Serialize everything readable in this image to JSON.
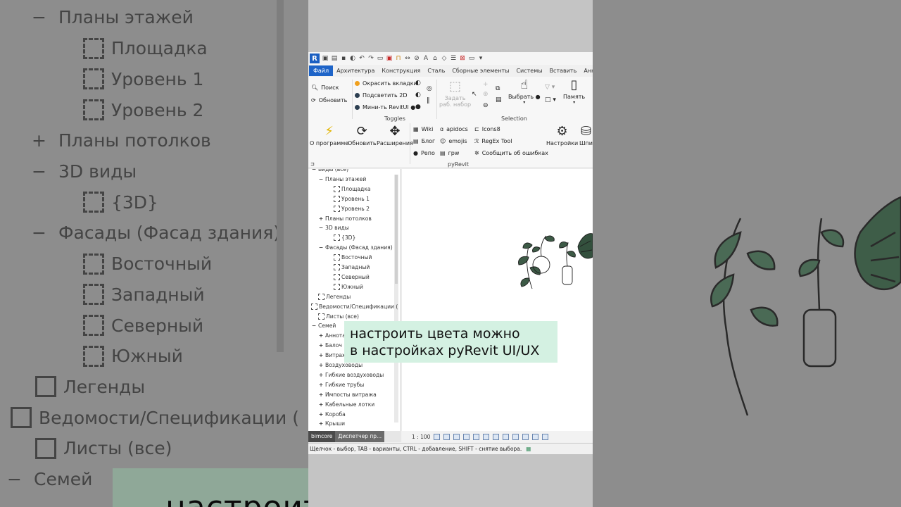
{
  "background_tree": [
    {
      "sign": "−",
      "label": "Планы этажей"
    },
    {
      "label": "Площадка"
    },
    {
      "label": "Уровень 1"
    },
    {
      "label": "Уровень 2"
    },
    {
      "sign": "+",
      "label": "Планы потолков"
    },
    {
      "sign": "−",
      "label": "3D виды"
    },
    {
      "label": "{3D}"
    },
    {
      "sign": "−",
      "label": "Фасады (Фасад здания)"
    },
    {
      "label": "Восточный"
    },
    {
      "label": "Западный"
    },
    {
      "label": "Северный"
    },
    {
      "label": "Южный"
    },
    {
      "label": "Легенды"
    },
    {
      "label": "Ведомости/Спецификации ("
    },
    {
      "label": "Листы (все)"
    },
    {
      "sign": "−",
      "label": "Семей"
    }
  ],
  "revit": {
    "logo": "R",
    "tabs": [
      "Файл",
      "Архитектура",
      "Конструкция",
      "Сталь",
      "Сборные элементы",
      "Системы",
      "Вставить",
      "Аннотац"
    ],
    "ribbon": {
      "search": "Поиск",
      "refresh": "Обновить",
      "toggles": [
        "Окрасить вкладки",
        "Подсветить 2D",
        "Мини-ть RevitUI ●"
      ],
      "toggles_label": "Toggles",
      "set_workset": [
        "Задать",
        "раб. набор"
      ],
      "select": "Выбрать ●",
      "memory": "Память",
      "selection_label": "Selection",
      "about": "О программе",
      "update": "Обновить",
      "extensions": "Расширения",
      "links_col1": [
        "Wiki",
        "Блог",
        "Репо"
      ],
      "links_col2": [
        "apidocs",
        "emojis",
        "гpw"
      ],
      "links_col3": [
        "Icons8",
        "RegEx Tool",
        "Сообщить об ошибках"
      ],
      "settings": "Настройки",
      "extra": "Шпи",
      "pyrevit_label": "pyRevit"
    },
    "browser": [
      {
        "sign": "−",
        "label": "Виды (все)",
        "indent": 0
      },
      {
        "sign": "−",
        "label": "Планы этажей",
        "indent": 1
      },
      {
        "box": true,
        "label": "Площадка",
        "indent": 2
      },
      {
        "box": true,
        "label": "Уровень 1",
        "indent": 2
      },
      {
        "box": true,
        "label": "Уровень 2",
        "indent": 2
      },
      {
        "sign": "+",
        "label": "Планы потолков",
        "indent": 1
      },
      {
        "sign": "−",
        "label": "3D виды",
        "indent": 1
      },
      {
        "box": true,
        "label": "{3D}",
        "indent": 2
      },
      {
        "sign": "−",
        "label": "Фасады (Фасад здания)",
        "indent": 1
      },
      {
        "box": true,
        "label": "Восточный",
        "indent": 2
      },
      {
        "box": true,
        "label": "Западный",
        "indent": 2
      },
      {
        "box": true,
        "label": "Северный",
        "indent": 2
      },
      {
        "box": true,
        "label": "Южный",
        "indent": 2
      },
      {
        "box": true,
        "label": "Легенды",
        "indent": 1
      },
      {
        "box": true,
        "label": "Ведомости/Спецификации (",
        "indent": 0
      },
      {
        "box": true,
        "label": "Листы (все)",
        "indent": 1
      },
      {
        "sign": "−",
        "label": "Семей",
        "indent": 0
      },
      {
        "sign": "+",
        "label": "Аннота",
        "indent": 1
      },
      {
        "sign": "+",
        "label": "Балоч",
        "indent": 1
      },
      {
        "sign": "+",
        "label": "Витрах",
        "indent": 1
      },
      {
        "sign": "+",
        "label": "Воздуховоды",
        "indent": 1
      },
      {
        "sign": "+",
        "label": "Гибкие воздуховоды",
        "indent": 1
      },
      {
        "sign": "+",
        "label": "Гибкие трубы",
        "indent": 1
      },
      {
        "sign": "+",
        "label": "Импосты витража",
        "indent": 1
      },
      {
        "sign": "+",
        "label": "Кабельные лотки",
        "indent": 1
      },
      {
        "sign": "+",
        "label": "Короба",
        "indent": 1
      },
      {
        "sign": "+",
        "label": "Крыши",
        "indent": 1
      }
    ],
    "bottom_tabs": [
      "bimcore",
      "Диспетчер пр..."
    ],
    "scale": "1 : 100",
    "status": "Щелчок - выбор, TAB - варианты, CTRL - добавление, SHIFT - снятие выбора."
  },
  "subtitle": {
    "line1": "настроить цвета можно",
    "line2": "в настройках pyRevit UI/UX"
  },
  "background_subtitle": "настроить цвета можно",
  "colors": {
    "file_tab": "#1e64c8",
    "toggle_orange": "#f0a01e",
    "toggle_dark": "#2c3e50",
    "subtitle_bg": "#d4f1e2"
  }
}
